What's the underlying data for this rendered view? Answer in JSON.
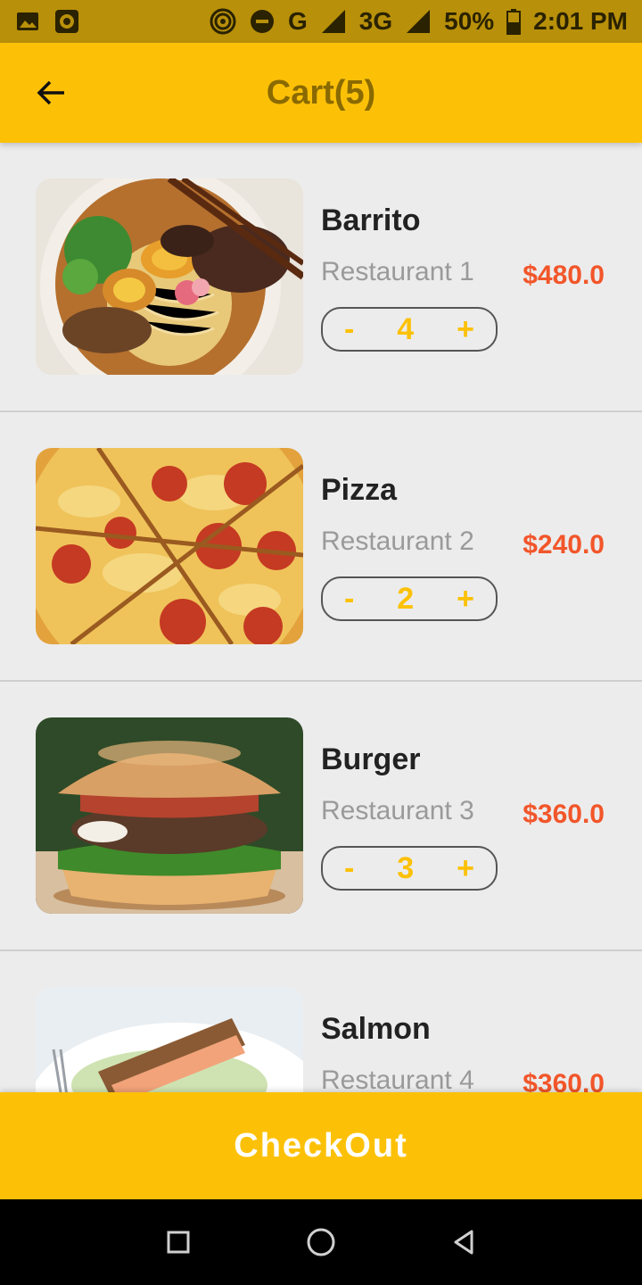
{
  "status_bar": {
    "network": "G",
    "network2": "3G",
    "battery": "50%",
    "time": "2:01 PM"
  },
  "toolbar": {
    "title": "Cart(5)",
    "back_icon": "arrow-left-icon"
  },
  "items": [
    {
      "name": "Barrito",
      "restaurant": "Restaurant 1",
      "price": "$480.0",
      "qty": "4",
      "minus": "-",
      "plus": "+",
      "image": "ramen-bowl"
    },
    {
      "name": "Pizza",
      "restaurant": "Restaurant 2",
      "price": "$240.0",
      "qty": "2",
      "minus": "-",
      "plus": "+",
      "image": "pepperoni-pizza"
    },
    {
      "name": "Burger",
      "restaurant": "Restaurant 3",
      "price": "$360.0",
      "qty": "3",
      "minus": "-",
      "plus": "+",
      "image": "bacon-burger"
    },
    {
      "name": "Salmon",
      "restaurant": "Restaurant 4",
      "price": "$360.0",
      "qty": "",
      "minus": "-",
      "plus": "+",
      "image": "salmon-plate"
    }
  ],
  "checkout": {
    "label": "CheckOut"
  },
  "colors": {
    "accent": "#fcc107",
    "price": "#f2562a",
    "status_bar": "#b8900a"
  }
}
